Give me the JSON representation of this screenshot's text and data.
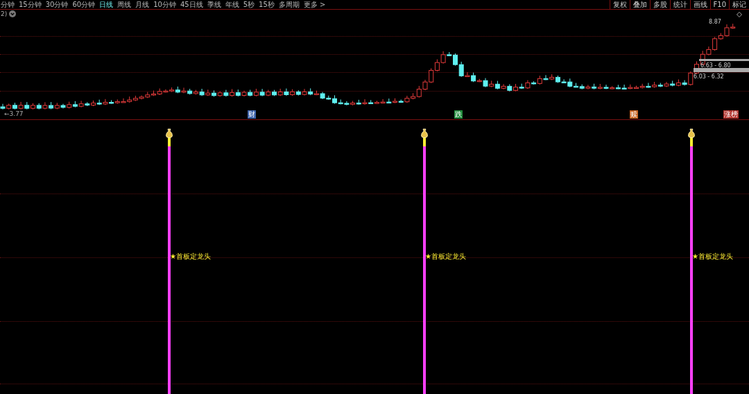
{
  "period_tabs": [
    {
      "label": "分钟",
      "selected": false
    },
    {
      "label": "15分钟",
      "selected": false
    },
    {
      "label": "30分钟",
      "selected": false
    },
    {
      "label": "60分钟",
      "selected": false
    },
    {
      "label": "日线",
      "selected": true
    },
    {
      "label": "周线",
      "selected": false
    },
    {
      "label": "月线",
      "selected": false
    },
    {
      "label": "10分钟",
      "selected": false
    },
    {
      "label": "45日线",
      "selected": false
    },
    {
      "label": "季线",
      "selected": false
    },
    {
      "label": "年线",
      "selected": false
    },
    {
      "label": "5秒",
      "selected": false
    },
    {
      "label": "15秒",
      "selected": false
    },
    {
      "label": "多周期",
      "selected": false
    },
    {
      "label": "更多 >",
      "selected": false
    }
  ],
  "toolbar_buttons": [
    "复权",
    "叠加",
    "多股",
    "统计",
    "画线",
    "F10",
    "标记"
  ],
  "price_chart": {
    "indicator_label": "2)",
    "high_label": "8.87",
    "low_label": "←3.77",
    "range_labels": [
      "6.63 - 6.80",
      "6.03 - 6.32"
    ],
    "event_tags": [
      {
        "label": "财",
        "color": "#3a5fa8"
      },
      {
        "label": "跌",
        "color": "#1f8a3a"
      },
      {
        "label": "赎",
        "color": "#c8621e"
      },
      {
        "label": "涨榜",
        "color": "#b0302a"
      }
    ]
  },
  "signal_panel": {
    "signals": [
      {
        "label": "★首板定龙头"
      },
      {
        "label": "★首板定龙头"
      },
      {
        "label": "★首板定龙头"
      }
    ]
  }
}
